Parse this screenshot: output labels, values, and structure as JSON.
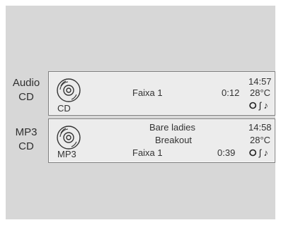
{
  "rows": [
    {
      "label_line1": "Audio",
      "label_line2": "CD",
      "source_tag": "CD",
      "disc_icon": "disc-icon",
      "track": "Faixa 1",
      "time": "0:12",
      "clock": "14:57",
      "temperature": "28°C",
      "icons": [
        "cd-status-icon",
        "bluetooth-icon",
        "music-note-icon"
      ]
    },
    {
      "label_line1": "MP3",
      "label_line2": "CD",
      "source_tag": "MP3",
      "disc_icon": "disc-icon",
      "artist": "Bare ladies",
      "album": "Breakout",
      "track": "Faixa 1",
      "time": "0:39",
      "clock": "14:58",
      "temperature": "28°C",
      "icons": [
        "cd-status-icon",
        "bluetooth-icon",
        "music-note-icon"
      ]
    }
  ],
  "colors": {
    "background": "#d7d7d7",
    "display": "#ececec",
    "border": "#7f7f7f"
  }
}
